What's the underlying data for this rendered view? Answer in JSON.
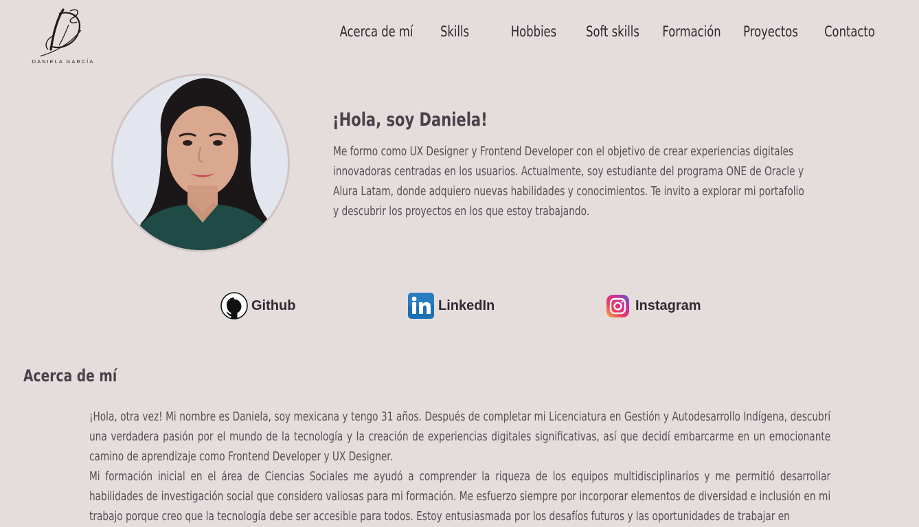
{
  "header": {
    "logo_name": "DANIELA GARCÍA",
    "nav": [
      {
        "label": "Acerca de mí"
      },
      {
        "label": "Skills"
      },
      {
        "label": "Hobbies"
      },
      {
        "label": "Soft skills"
      },
      {
        "label": "Formación"
      },
      {
        "label": "Proyectos"
      },
      {
        "label": "Contacto"
      }
    ]
  },
  "hero": {
    "title": "¡Hola, soy Daniela!",
    "text": "Me formo como UX Designer y Frontend Developer con el objetivo de crear experiencias digitales innovadoras centradas en los usuarios. Actualmente, soy estudiante del programa ONE de Oracle y Alura Latam, donde adquiero nuevas habilidades y conocimientos. Te invito a explorar mi portafolio y descubrir los proyectos en los que estoy trabajando."
  },
  "social": [
    {
      "label": "Github",
      "icon": "github-icon"
    },
    {
      "label": "LinkedIn",
      "icon": "linkedin-icon"
    },
    {
      "label": "Instagram",
      "icon": "instagram-icon"
    }
  ],
  "about": {
    "title": "Acerca de mí",
    "paragraphs": [
      "¡Hola, otra vez! Mi nombre es Daniela, soy mexicana y tengo 31 años. Después de completar mi Licenciatura en Gestión y Autodesarrollo Indígena, descubrí una verdadera pasión por el mundo de la tecnología y la creación de experiencias digitales significativas, así que decidí embarcarme en un emocionante camino de aprendizaje como Frontend Developer y UX Designer.",
      "Mi formación inicial en el área de Ciencias Sociales me ayudó a comprender la riqueza de los equipos multidisciplinarios y me permitió desarrollar habilidades de investigación social que considero valiosas para mi formación. Me esfuerzo siempre por incorporar elementos de diversidad e inclusión en mi trabajo porque creo que la tecnología debe ser accesible para todos. Estoy entusiasmada por los desafíos futuros y las oportunidades de trabajar en"
    ]
  },
  "colors": {
    "background": "#e5dddc",
    "text": "#554e55",
    "heading": "#47424a"
  }
}
